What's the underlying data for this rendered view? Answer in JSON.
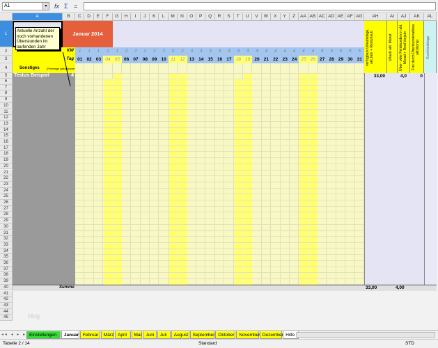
{
  "toolbar": {
    "cell_ref": "A1",
    "icons": [
      "function-wizard-icon",
      "sum-icon",
      "equals-icon"
    ],
    "formula": ""
  },
  "sheet": {
    "month_title": "Januar 2014",
    "comment": "Aktuelle Anzahl der noch vorhandenen Überstunden im laufenden Jahr",
    "kw_label": "KW",
    "tag_label": "Tag",
    "sonstiges_label": "Sonstiges",
    "sonstiges_note": "(Feiertage geschlossen)",
    "kw": [
      1,
      1,
      1,
      1,
      1,
      2,
      2,
      2,
      2,
      2,
      2,
      2,
      3,
      3,
      3,
      3,
      3,
      3,
      3,
      4,
      4,
      4,
      4,
      4,
      4,
      4,
      5,
      5,
      5,
      5,
      5
    ],
    "days": [
      "01",
      "02",
      "03",
      "04",
      "05",
      "06",
      "07",
      "08",
      "09",
      "10",
      "11",
      "12",
      "13",
      "14",
      "15",
      "16",
      "17",
      "18",
      "19",
      "20",
      "21",
      "22",
      "23",
      "24",
      "25",
      "26",
      "27",
      "28",
      "29",
      "30",
      "31"
    ],
    "weekend_days": [
      "04",
      "05",
      "11",
      "12",
      "18",
      "19",
      "25",
      "26"
    ],
    "right_headers": {
      "ah": "verfügbare Urlaubstage, akt.Jahr + Resturlaub",
      "ai": "Urlaub akt. Monat",
      "aj": "Über- oder Fehlstunden in akt. Monat + Rest Vorjahr",
      "ak": "Frei durch Überstundenabbau akt.Monat",
      "al": "Krankheitstage"
    },
    "employee": {
      "name": "Testus Beispiel",
      "value": "4",
      "ah": "33,00",
      "ai": "4,0",
      "aj": "0"
    },
    "sum_label": "Summe",
    "sum_ah": "33,00",
    "sum_ai": "4,00",
    "watermark": "blog"
  },
  "columns": [
    "A",
    "B",
    "C",
    "D",
    "E",
    "F",
    "G",
    "H",
    "I",
    "J",
    "K",
    "L",
    "M",
    "N",
    "O",
    "P",
    "Q",
    "R",
    "S",
    "T",
    "U",
    "V",
    "W",
    "X",
    "Y",
    "Z",
    "AA",
    "AB",
    "AC",
    "AD",
    "AE",
    "AF",
    "AG",
    "AH",
    "AI",
    "AJ",
    "AK",
    "AL"
  ],
  "tabs": [
    "Einstellungen",
    "Januar",
    "Februar",
    "März",
    "April",
    "Mai",
    "Juni",
    "Juli",
    "August",
    "September",
    "Oktober",
    "November",
    "Dezember",
    "Hilfe"
  ],
  "active_tab": "Januar",
  "status": {
    "sheet": "Tabelle 2 / 14",
    "style": "Standard",
    "mode": "STD"
  },
  "colors": {
    "orange": "#e65f3c",
    "blue": "#a4c6ee",
    "yellow": "#ffff00",
    "pale": "#f8f8c4",
    "weekend": "#ffff70",
    "gray": "#9a9a9a",
    "lavender": "#e4e4f4",
    "cyan": "#ccf2f2",
    "tab_green": "#33dd33"
  }
}
